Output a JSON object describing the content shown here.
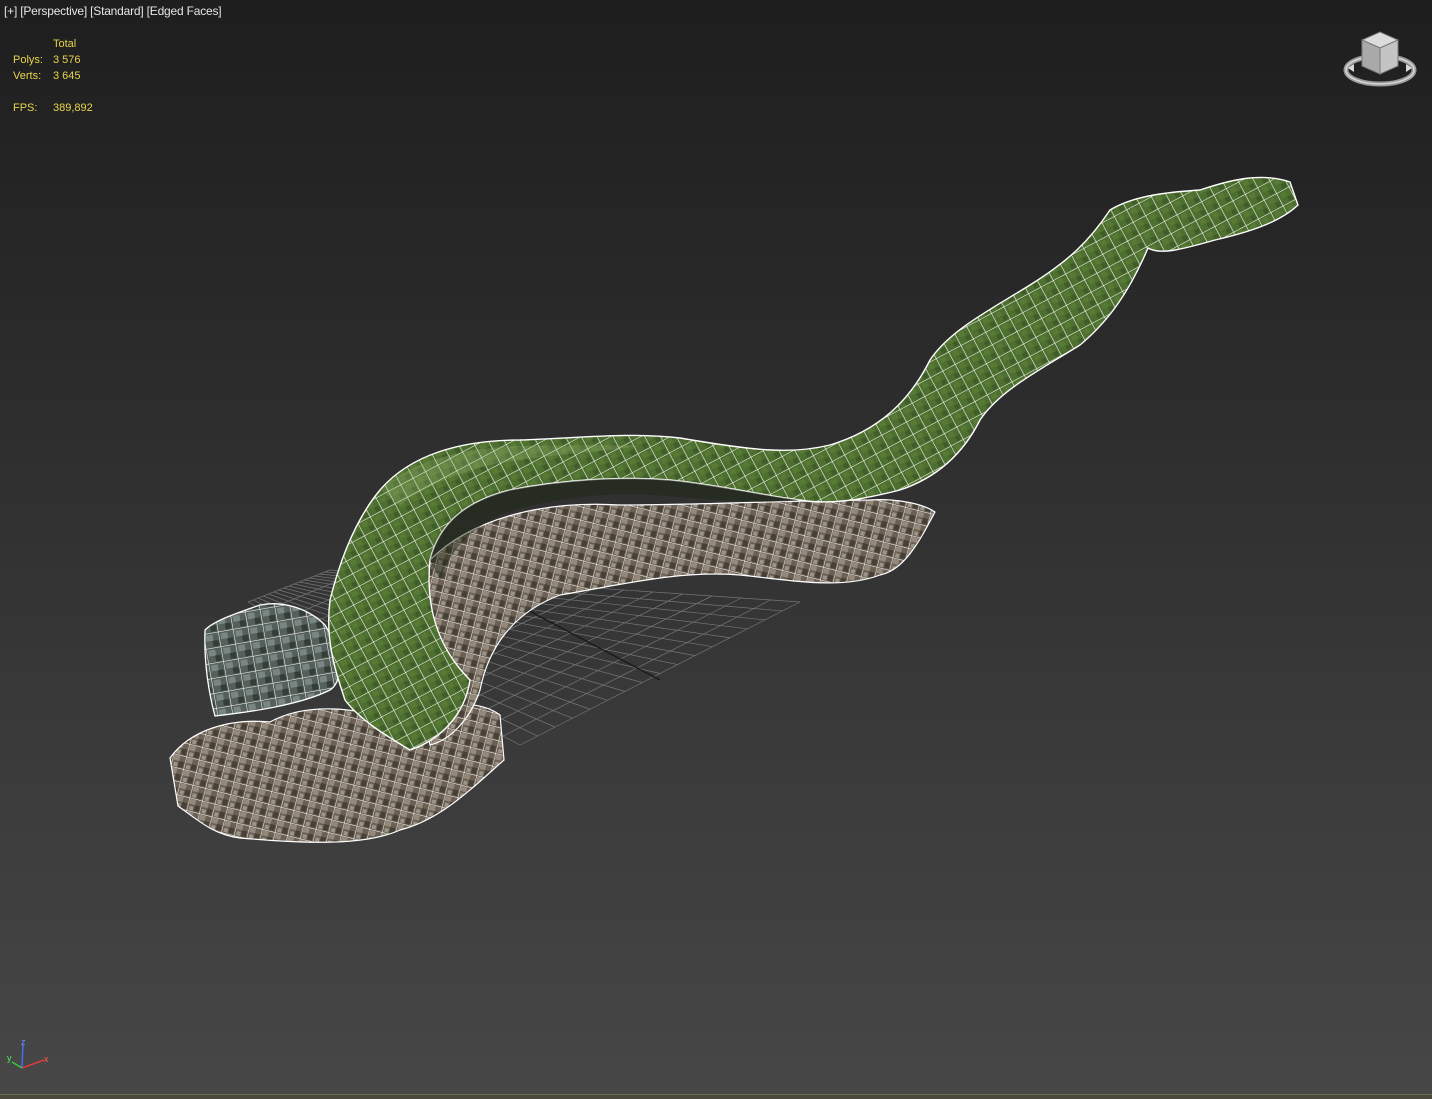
{
  "viewport": {
    "labels": {
      "plus": "[+]",
      "view": "[Perspective]",
      "shading": "[Standard]",
      "mode": "[Edged Faces]"
    },
    "stats": {
      "header": "Total",
      "polys_label": "Polys:",
      "polys_value": "3 576",
      "verts_label": "Verts:",
      "verts_value": "3 645",
      "fps_label": "FPS:",
      "fps_value": "389,892"
    },
    "colors": {
      "background_top": "#1e1e1e",
      "background_bottom": "#474747",
      "stats_text": "#e8d44d",
      "wire": "#ffffff",
      "root_green": "#4b6e2e",
      "rock_base": "#7a6f62",
      "grid": "#8a8a8a"
    },
    "icons": {
      "viewcube": "viewcube-icon",
      "axis": "axis-tripod-icon"
    },
    "axis": {
      "x": "x",
      "y": "y",
      "z": "z"
    }
  }
}
